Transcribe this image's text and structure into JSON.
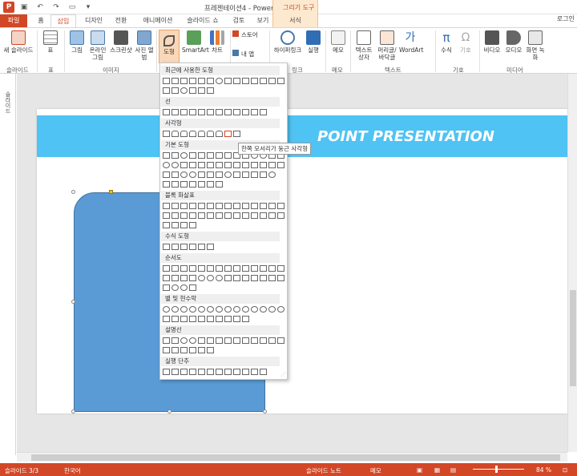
{
  "window": {
    "title": "프레젠테이션4 - PowerPoint",
    "context_tool": "그리기 도구",
    "login": "로그인"
  },
  "tabs": [
    {
      "label": "파일"
    },
    {
      "label": "홈"
    },
    {
      "label": "삽입"
    },
    {
      "label": "디자인"
    },
    {
      "label": "전환"
    },
    {
      "label": "애니메이션"
    },
    {
      "label": "슬라이드 쇼"
    },
    {
      "label": "검토"
    },
    {
      "label": "보기"
    },
    {
      "label": "서식"
    }
  ],
  "ribbon": {
    "buttons": [
      "새 슬라이드",
      "표",
      "그림",
      "온라인 그림",
      "스크린샷",
      "사진 앨범",
      "도형",
      "SmartArt",
      "차트",
      "스토어",
      "내 앱",
      "하이퍼링크",
      "실행",
      "메모",
      "텍스트 상자",
      "머리글/바닥글",
      "WordArt",
      "수식",
      "기호",
      "비디오",
      "오디오",
      "화면 녹화"
    ],
    "groups": [
      "슬라이드",
      "표",
      "이미지",
      "링크",
      "메모",
      "텍스트",
      "기호",
      "미디어"
    ]
  },
  "left_pane": {
    "label": "슬라이드"
  },
  "slide": {
    "banner_text": "POINT PRESENTATION"
  },
  "shapes_menu": {
    "sections": [
      "최근에 사용한 도형",
      "선",
      "사각형",
      "기본 도형",
      "블록 화살표",
      "수식 도형",
      "순서도",
      "별 및 현수막",
      "설명선",
      "실행 단추"
    ],
    "tooltip": "한쪽 모서리가 둥근 사각형"
  },
  "status": {
    "slide_indicator": "슬라이드 3/3",
    "language": "한국어",
    "notes": "슬라이드 노트",
    "comments": "메모",
    "zoom": "84 %"
  },
  "colors": {
    "accent": "#d24726",
    "banner": "#4fc3f3",
    "shape": "#5b9bd5"
  }
}
